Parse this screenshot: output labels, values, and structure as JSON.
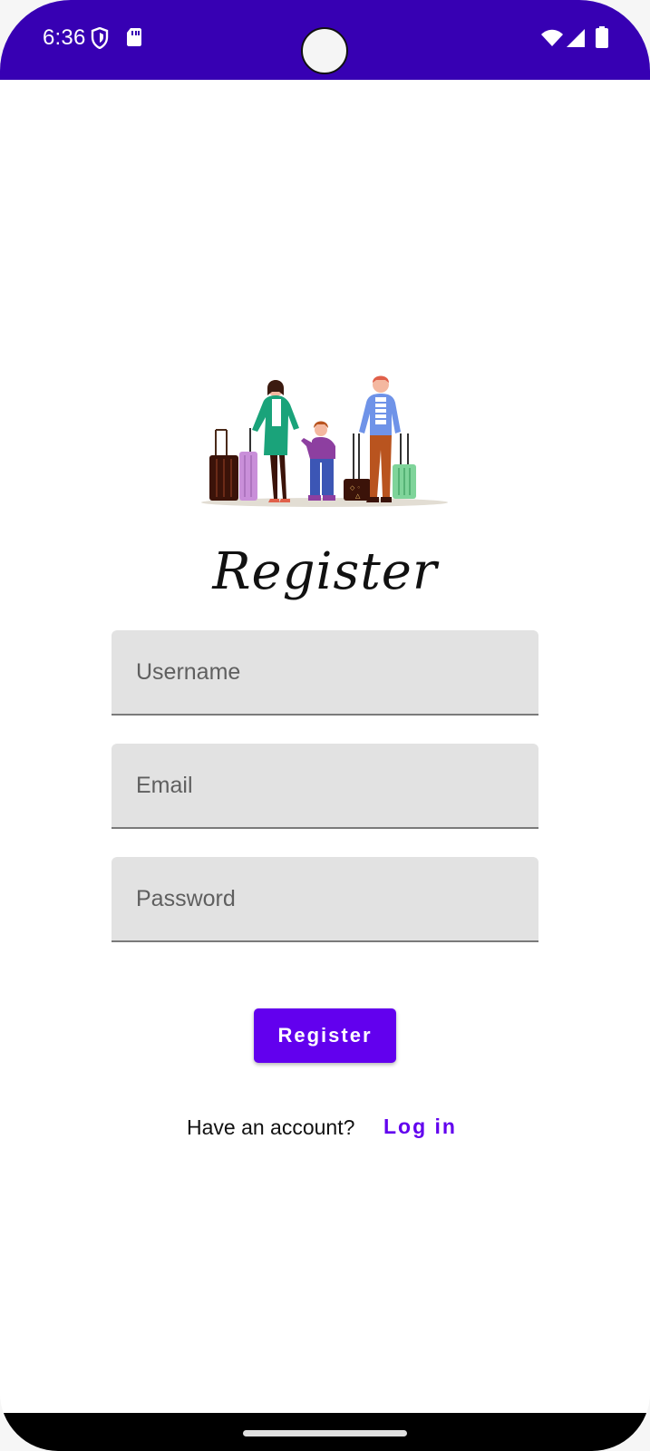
{
  "status_bar": {
    "time": "6:36",
    "left_icons": [
      "shield-icon",
      "sd-card-icon"
    ],
    "right_icons": [
      "wifi-icon",
      "signal-icon",
      "battery-icon"
    ],
    "background": "#3700b3"
  },
  "form": {
    "title": "Register",
    "username_placeholder": "Username",
    "email_placeholder": "Email",
    "password_placeholder": "Password",
    "submit_label": "Register"
  },
  "footer": {
    "prompt": "Have an account?",
    "login_label": "Log in"
  },
  "colors": {
    "accent": "#6200ee",
    "status_bar": "#3700b3",
    "field_background": "#e2e2e2"
  }
}
